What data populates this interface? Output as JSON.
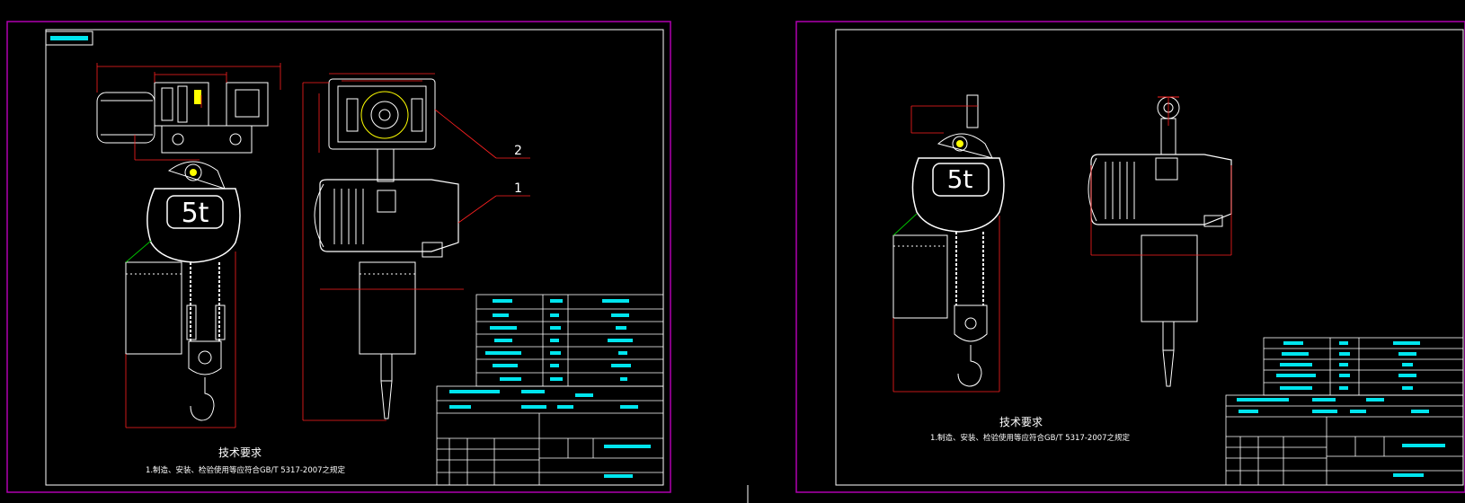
{
  "colors": {
    "background": "#000000",
    "sheet_border": "#b000b0",
    "frame": "#ffffff",
    "dimension": "#ff2020",
    "highlight": "#00e5ee",
    "leader": "#00c000",
    "marker": "#ffff00"
  },
  "sheets": [
    {
      "capacity_label": "5t",
      "tech_title": "技术要求",
      "tech_note": "1.制造、安装、检验使用等应符合GB/T 5317-2007之规定",
      "callouts": [
        "2",
        "1"
      ]
    },
    {
      "capacity_label": "5t",
      "tech_title": "技术要求",
      "tech_note": "1.制造、安装、检验使用等应符合GB/T 5317-2007之规定"
    }
  ]
}
